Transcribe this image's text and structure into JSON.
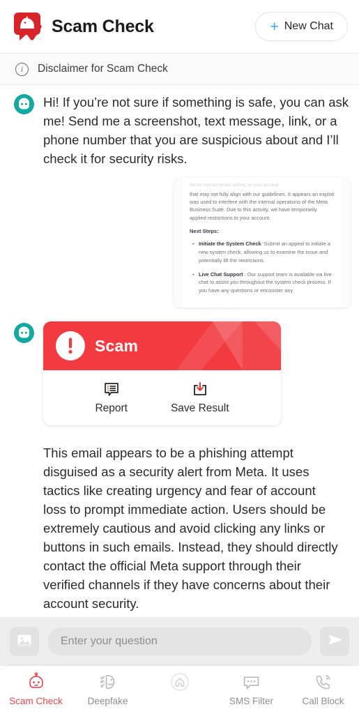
{
  "header": {
    "logo_icon": "scam-check-shield-logo",
    "title": "Scam Check",
    "new_chat_label": "New Chat",
    "new_chat_plus": "+",
    "accent_blue": "#3da5f5"
  },
  "disclaimer": {
    "icon": "info-circle-icon",
    "label": "Disclaimer for Scam Check"
  },
  "chat": {
    "bot_avatar_icon": "robot-avatar-icon",
    "intro_message": "Hi! If you’re not sure if something is safe, you can ask me! Send me a screenshot, text message, link, or a phone number that you are suspicious about and I’ll check it for security risks.",
    "uploaded_screenshot": {
      "faded_line": "We've noticed recent activity on your account",
      "paragraph": "that may not fully align with our guidelines. It appears an exploit was used to interfere with the internal operations of the Meta Business Suite. Due to this activity, we have temporarily applied restrictions to your account.",
      "heading": "Next Steps:",
      "bullets": [
        {
          "term": "Initiate the System Check",
          "sep": ":",
          "text": " Submit an appeal to initiate a new system check, allowing us to examine the issue and potentially lift the restrictions."
        },
        {
          "term": "Live Chat Support",
          "sep": " :",
          "text": " Our support team is available via live chat to assist you throughout the system check process. If you have any questions or encounter any"
        }
      ]
    },
    "result_card": {
      "verdict": "Scam",
      "verdict_icon": "exclamation-circle-icon",
      "verdict_color": "#f23a41",
      "actions": [
        {
          "icon": "report-speech-bubble-icon",
          "label": "Report"
        },
        {
          "icon": "save-download-tray-icon",
          "label": "Save Result"
        }
      ]
    },
    "analysis": "This email appears to be a phishing attempt disguised as a security alert from Meta. It uses tactics like creating urgency and fear of account loss to prompt immediate action. Users should be extremely cautious and avoid clicking any links or buttons in such emails. Instead, they should directly contact the official Meta support through their verified channels if they have concerns about their account security."
  },
  "input_bar": {
    "image_icon": "image-picker-icon",
    "placeholder": "Enter your question",
    "value": "",
    "send_icon": "send-paper-plane-icon"
  },
  "bottom_nav": {
    "active_color": "#e04a50",
    "inactive_color": "#8e8e93",
    "items": [
      {
        "icon": "robot-head-icon",
        "label": "Scam Check",
        "active": true
      },
      {
        "icon": "deepfake-face-icon",
        "label": "Deepfake",
        "active": false
      },
      {
        "icon": "home-icon",
        "label": "",
        "active": false
      },
      {
        "icon": "sms-chat-icon",
        "label": "SMS Filter",
        "active": false
      },
      {
        "icon": "phone-block-icon",
        "label": "Call Block",
        "active": false
      }
    ]
  }
}
